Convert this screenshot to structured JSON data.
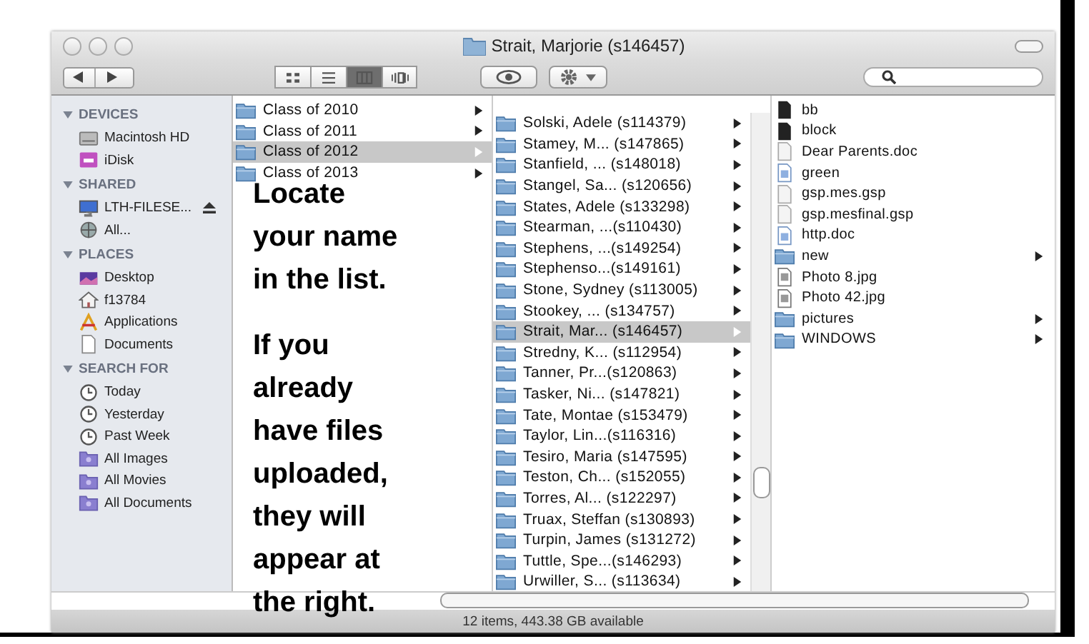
{
  "window": {
    "title": "Strait, Marjorie (s146457)"
  },
  "toolbar": {
    "view_buttons": [
      {
        "kind": "icons",
        "selected": false
      },
      {
        "kind": "list",
        "selected": false
      },
      {
        "kind": "columns",
        "selected": true
      },
      {
        "kind": "coverflow",
        "selected": false
      }
    ]
  },
  "sidebar": {
    "sections": [
      {
        "heading": "DEVICES",
        "items": [
          {
            "label": "Macintosh HD",
            "kind": "drive"
          },
          {
            "label": "iDisk",
            "kind": "idisk"
          }
        ]
      },
      {
        "heading": "SHARED",
        "items": [
          {
            "label": "LTH-FILESE...",
            "kind": "computer",
            "eject": true
          },
          {
            "label": "All...",
            "kind": "network"
          }
        ]
      },
      {
        "heading": "PLACES",
        "items": [
          {
            "label": "Desktop",
            "kind": "desktop"
          },
          {
            "label": "f13784",
            "kind": "home"
          },
          {
            "label": "Applications",
            "kind": "apps"
          },
          {
            "label": "Documents",
            "kind": "documents"
          }
        ]
      },
      {
        "heading": "SEARCH FOR",
        "items": [
          {
            "label": "Today",
            "kind": "clock"
          },
          {
            "label": "Yesterday",
            "kind": "clock"
          },
          {
            "label": "Past Week",
            "kind": "clock"
          },
          {
            "label": "All Images",
            "kind": "smart"
          },
          {
            "label": "All Movies",
            "kind": "smart"
          },
          {
            "label": "All Documents",
            "kind": "smart"
          }
        ]
      }
    ]
  },
  "columns": [
    {
      "items": [
        {
          "label": "Class of 2010",
          "kind": "folder",
          "selected": false
        },
        {
          "label": "Class of 2011",
          "kind": "folder",
          "selected": false
        },
        {
          "label": "Class of 2012",
          "kind": "folder",
          "selected": true
        },
        {
          "label": "Class of 2013",
          "kind": "folder",
          "selected": false
        }
      ]
    },
    {
      "items": [
        {
          "label": "Solski, Adele (s114379)",
          "kind": "folder",
          "selected": false
        },
        {
          "label": "Stamey, M... (s147865)",
          "kind": "folder",
          "selected": false
        },
        {
          "label": "Stanfield, ... (s148018)",
          "kind": "folder",
          "selected": false
        },
        {
          "label": "Stangel, Sa... (s120656)",
          "kind": "folder",
          "selected": false
        },
        {
          "label": "States, Adele (s133298)",
          "kind": "folder",
          "selected": false
        },
        {
          "label": "Stearman, ...(s110430)",
          "kind": "folder",
          "selected": false
        },
        {
          "label": "Stephens, ...(s149254)",
          "kind": "folder",
          "selected": false
        },
        {
          "label": "Stephenso...(s149161)",
          "kind": "folder",
          "selected": false
        },
        {
          "label": "Stone, Sydney (s113005)",
          "kind": "folder",
          "selected": false
        },
        {
          "label": "Stookey, ... (s134757)",
          "kind": "folder",
          "selected": false
        },
        {
          "label": "Strait, Mar... (s146457)",
          "kind": "folder",
          "selected": true
        },
        {
          "label": "Stredny, K... (s112954)",
          "kind": "folder",
          "selected": false
        },
        {
          "label": "Tanner, Pr...(s120863)",
          "kind": "folder",
          "selected": false
        },
        {
          "label": "Tasker, Ni... (s147821)",
          "kind": "folder",
          "selected": false
        },
        {
          "label": "Tate, Montae (s153479)",
          "kind": "folder",
          "selected": false
        },
        {
          "label": "Taylor, Lin...(s116316)",
          "kind": "folder",
          "selected": false
        },
        {
          "label": "Tesiro, Maria (s147595)",
          "kind": "folder",
          "selected": false
        },
        {
          "label": "Teston, Ch... (s152055)",
          "kind": "folder",
          "selected": false
        },
        {
          "label": "Torres, Al... (s122297)",
          "kind": "folder",
          "selected": false
        },
        {
          "label": "Truax, Steffan (s130893)",
          "kind": "folder",
          "selected": false
        },
        {
          "label": "Turpin, James (s131272)",
          "kind": "folder",
          "selected": false
        },
        {
          "label": "Tuttle, Spe...(s146293)",
          "kind": "folder",
          "selected": false
        },
        {
          "label": "Urwiller, S... (s113634)",
          "kind": "folder",
          "selected": false
        }
      ]
    },
    {
      "items": [
        {
          "label": "bb",
          "kind": "blackfile",
          "selected": false
        },
        {
          "label": "block",
          "kind": "blackfile",
          "selected": false
        },
        {
          "label": "Dear Parents.doc",
          "kind": "blank",
          "selected": false
        },
        {
          "label": "green",
          "kind": "textdoc",
          "selected": false
        },
        {
          "label": "gsp.mes.gsp",
          "kind": "blank",
          "selected": false
        },
        {
          "label": "gsp.mesfinal.gsp",
          "kind": "blank",
          "selected": false
        },
        {
          "label": "http.doc",
          "kind": "textdoc",
          "selected": false
        },
        {
          "label": "new",
          "kind": "folder",
          "selected": false
        },
        {
          "label": "Photo 8.jpg",
          "kind": "image",
          "selected": false
        },
        {
          "label": "Photo 42.jpg",
          "kind": "image",
          "selected": false
        },
        {
          "label": "pictures",
          "kind": "folder",
          "selected": false
        },
        {
          "label": "WINDOWS",
          "kind": "folder",
          "selected": false
        }
      ]
    }
  ],
  "annotation": [
    "Locate your name in the list.",
    "If you already have files uploaded, they will appear at the right."
  ],
  "status_bar": "12 items, 443.38 GB available"
}
